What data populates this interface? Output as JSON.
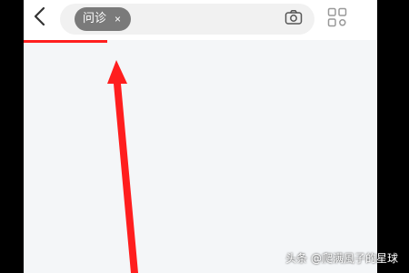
{
  "search": {
    "chip_label": "问诊",
    "chip_close": "×"
  },
  "icons": {
    "back": "chevron-left-icon",
    "clear": "close-icon",
    "camera": "camera-icon",
    "grid": "grid-icon"
  },
  "colors": {
    "accent": "#ff1f1f",
    "chip_bg": "#7a7a7a",
    "page_bg": "#f4f6f8"
  },
  "watermark": "头条 @爬满風子的星球"
}
